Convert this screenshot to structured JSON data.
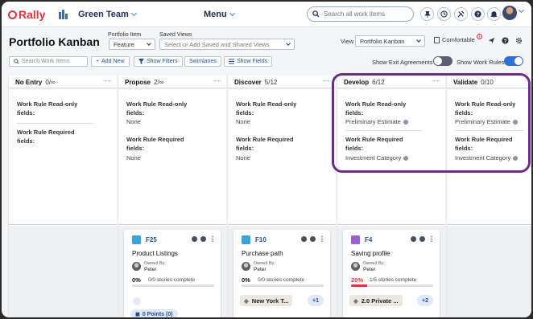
{
  "topbar": {
    "logo": "Rally",
    "team": "Green Team",
    "menu": "Menu",
    "search_placeholder": "Search all work items"
  },
  "header": {
    "title": "Portfolio Kanban",
    "portfolio_item_label": "Portfolio Item",
    "portfolio_item_value": "Feature",
    "saved_views_label": "Saved Views",
    "saved_views_placeholder": "Select or Add Saved and Shared Views",
    "view_label": "View",
    "view_value": "Portfolio Kanban",
    "comfortable": "Comfortable",
    "comfortable_badge": "1"
  },
  "toolbar": {
    "search_placeholder": "Search Work Items",
    "add_new": "Add New",
    "show_filters": "Show Filters",
    "swimlanes": "Swimlanes",
    "show_fields": "Show Fields",
    "show_exit_agreements": "Show Exit Agreements",
    "show_work_rules": "Show Work Rules",
    "exit_agreements_on": false,
    "work_rules_on": true
  },
  "colors": {
    "accent": "#2f6fd6",
    "brand": "#e0343a",
    "highlight": "#6b2c88"
  },
  "columns": [
    {
      "name": "No Entry",
      "wip": "0/∞",
      "readonly_title": "Work Rule Read-only fields:",
      "readonly_value": "",
      "required_title": "Work Rule Required fields:",
      "required_value": ""
    },
    {
      "name": "Propose",
      "wip": "2/∞",
      "readonly_title": "Work Rule Read-only fields:",
      "readonly_value": "None",
      "required_title": "Work Rule Required fields:",
      "required_value": "None"
    },
    {
      "name": "Discover",
      "wip": "5/12",
      "readonly_title": "Work Rule Read-only fields:",
      "readonly_value": "None",
      "required_title": "Work Rule Required fields:",
      "required_value": "None"
    },
    {
      "name": "Develop",
      "wip": "6/12",
      "readonly_title": "Work Rule Read-only fields:",
      "readonly_value": "Preliminary Estimate",
      "required_title": "Work Rule Required fields:",
      "required_value": "Investment Category"
    },
    {
      "name": "Validate",
      "wip": "0/10",
      "readonly_title": "Work Rule Read-only fields:",
      "readonly_value": "Preliminary Estimate",
      "required_title": "Work Rule Required fields:",
      "required_value": "Investment Category"
    }
  ],
  "cards": [
    {
      "id": "F25",
      "name": "Product Listings",
      "owned_by_label": "Owned By:",
      "owner": "Peter",
      "pct": "0%",
      "stories": "0/0 stories complete",
      "progress": 0,
      "points": "0 Points (0)",
      "type_color": "#3aa3d8"
    },
    {
      "id": "F10",
      "name": "Purchase path",
      "owned_by_label": "Owned By:",
      "owner": "Peter",
      "pct": "0%",
      "stories": "0/0 stories complete",
      "progress": 0,
      "tag": "New York T...",
      "more": "+1",
      "type_color": "#3aa3d8"
    },
    {
      "id": "F4",
      "name": "Saving profile",
      "owned_by_label": "Owned By:",
      "owner": "Peter",
      "pct": "20%",
      "stories": "1/5 stories complete",
      "progress": 0.2,
      "tag": "2.0 Private ...",
      "more": "+2",
      "type_color": "#9a5fd0"
    }
  ]
}
